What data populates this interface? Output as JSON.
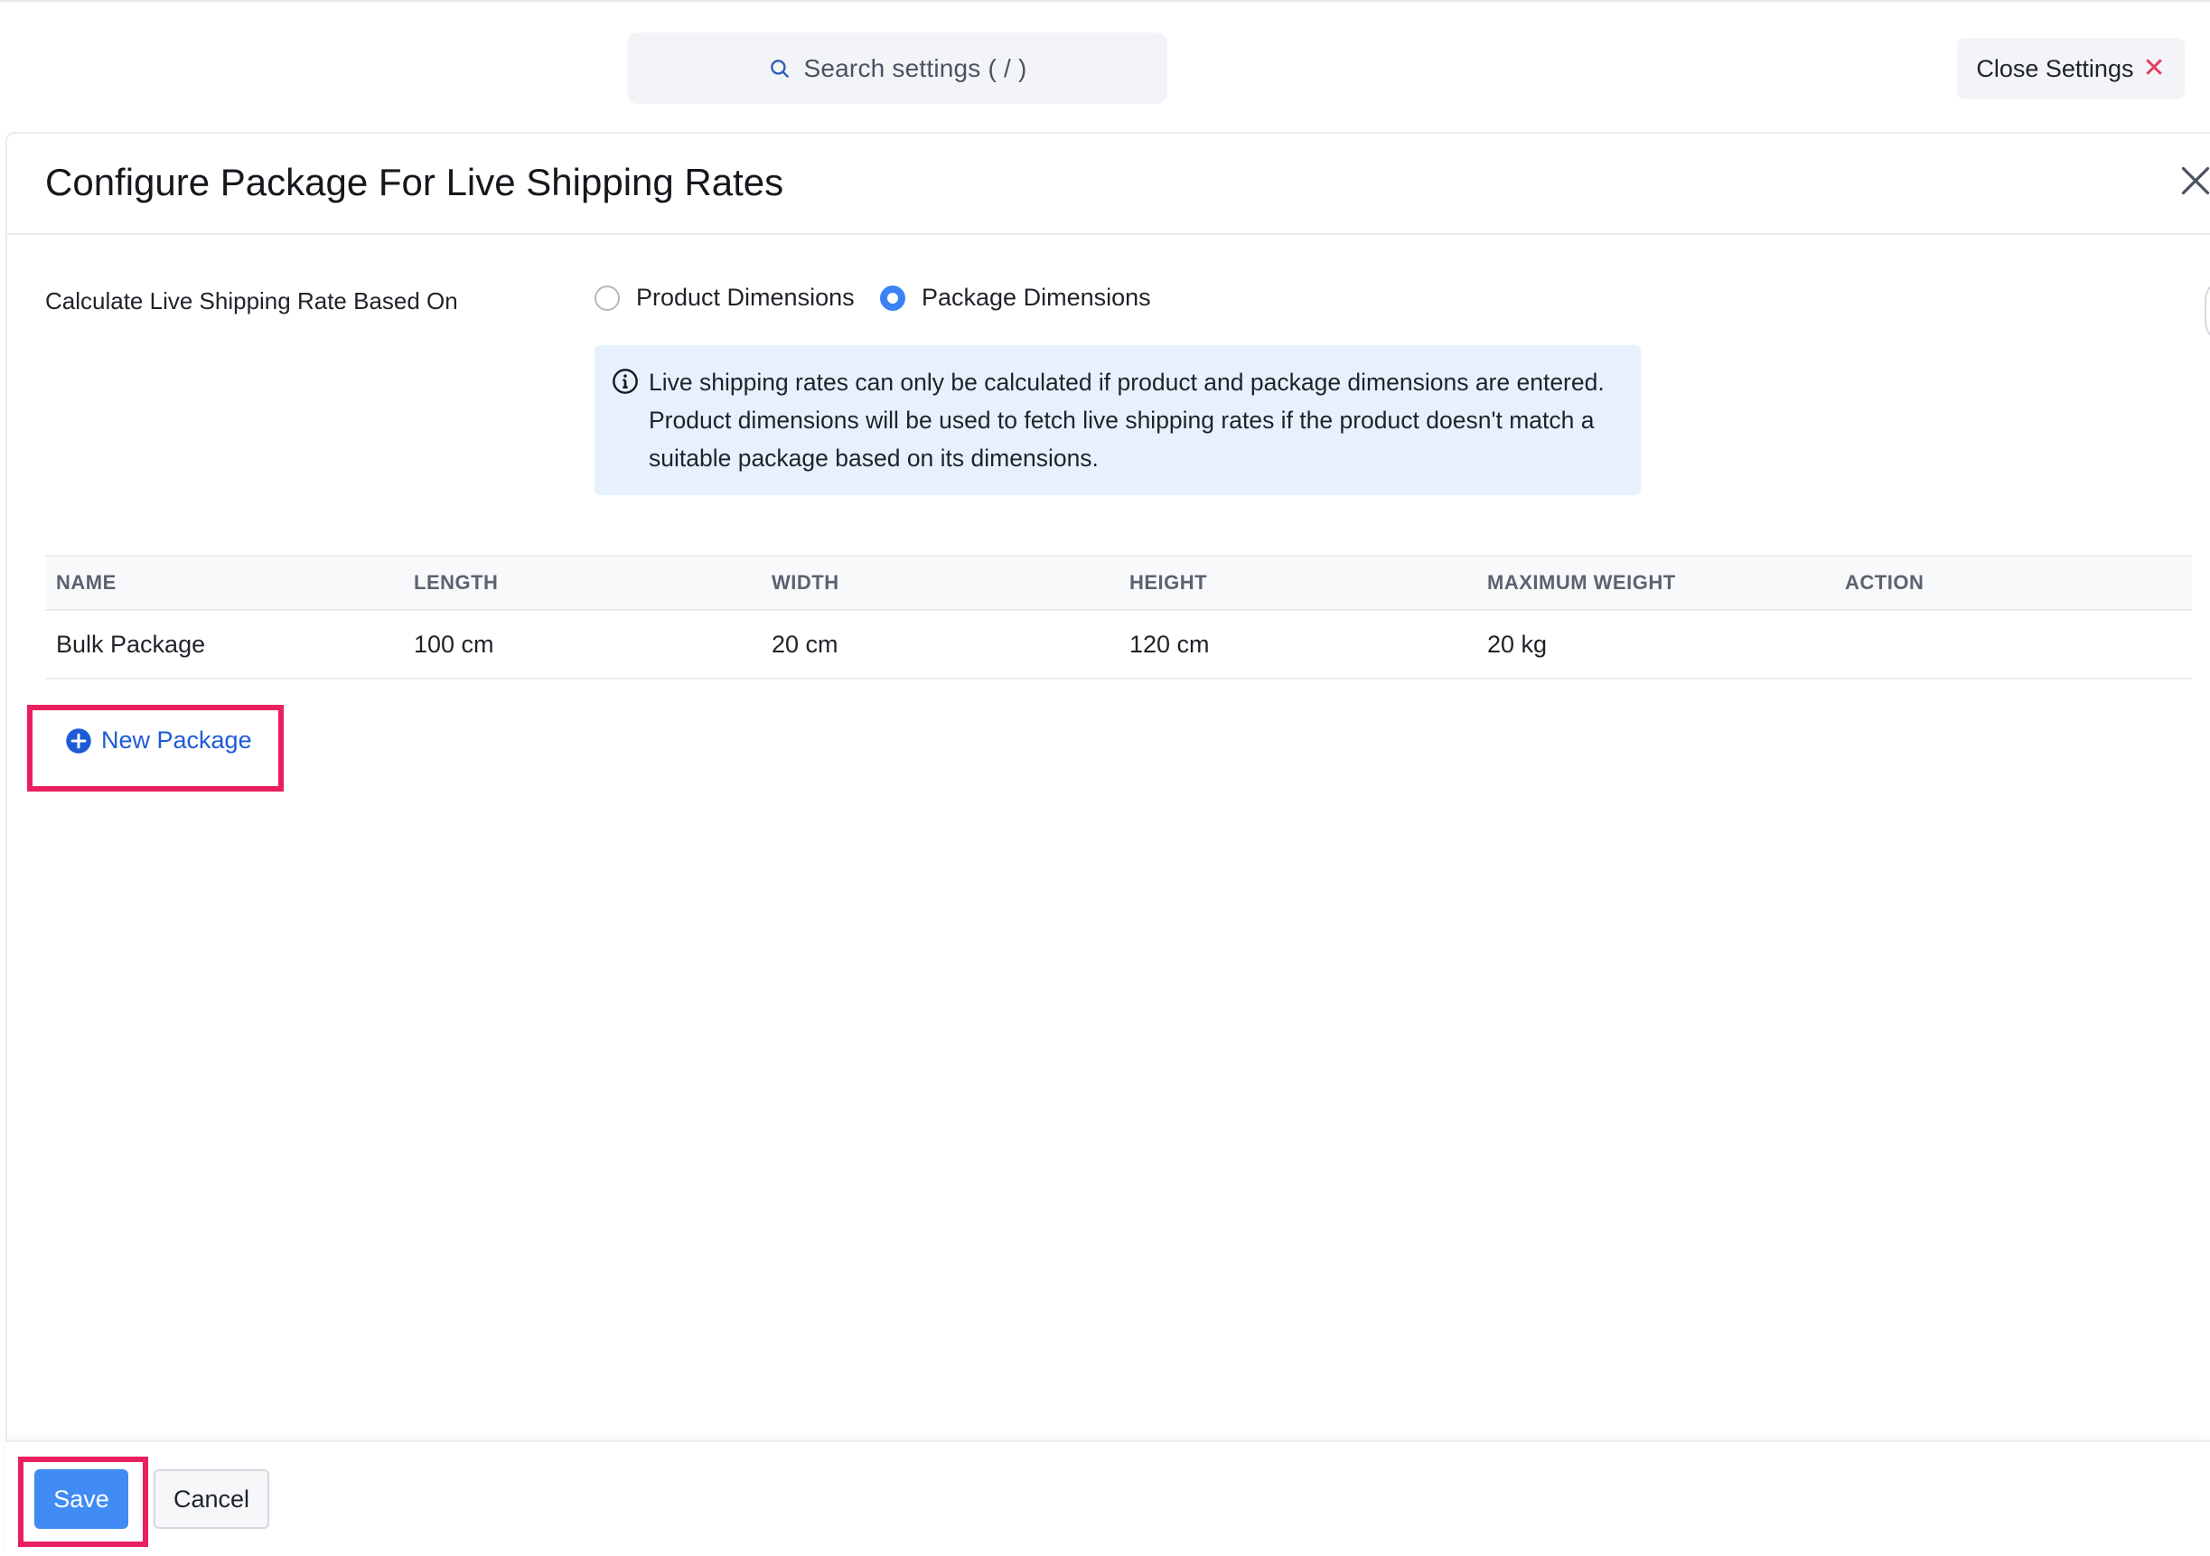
{
  "header": {
    "search_placeholder": "Search settings ( / )",
    "close_settings_label": "Close Settings",
    "close_settings_icon": "close-icon",
    "close_icon_color": "#e53a5c"
  },
  "panel": {
    "title": "Configure Package For Live Shipping Rates",
    "rate_based_on": {
      "label": "Calculate Live Shipping Rate Based On",
      "options": [
        {
          "label": "Product Dimensions",
          "selected": false
        },
        {
          "label": "Package Dimensions",
          "selected": true
        }
      ]
    },
    "info_message": "Live shipping rates can only be calculated if product and package dimensions are entered. Product dimensions will be used to fetch live shipping rates if the product doesn't match a suitable package based on its dimensions.",
    "table": {
      "columns": [
        "NAME",
        "LENGTH",
        "WIDTH",
        "HEIGHT",
        "MAXIMUM WEIGHT",
        "ACTION"
      ],
      "rows": [
        {
          "name": "Bulk Package",
          "length": "100 cm",
          "width": "20 cm",
          "height": "120 cm",
          "max_weight": "20 kg",
          "action": ""
        }
      ]
    },
    "new_package_label": "New Package"
  },
  "footer": {
    "save_label": "Save",
    "cancel_label": "Cancel"
  },
  "colors": {
    "accent": "#418bf5",
    "link": "#1e5bd6",
    "info_bg": "#e6f1fd",
    "highlight": "#ea1f5e"
  }
}
